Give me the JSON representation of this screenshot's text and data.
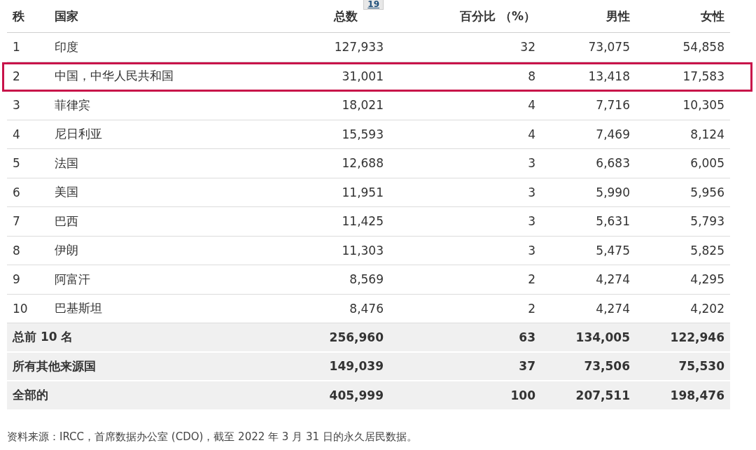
{
  "table": {
    "columns": [
      {
        "label": "秩"
      },
      {
        "label": "国家"
      },
      {
        "label": "总数",
        "footnote": "19"
      },
      {
        "label": "百分比 （%）"
      },
      {
        "label": "男性"
      },
      {
        "label": "女性"
      }
    ],
    "rows": [
      {
        "cells": [
          "1",
          "印度",
          "127,933",
          "32",
          "73,075",
          "54,858"
        ],
        "highlighted": false,
        "summary": false
      },
      {
        "cells": [
          "2",
          "中国，中华人民共和国",
          "31,001",
          "8",
          "13,418",
          "17,583"
        ],
        "highlighted": true,
        "summary": false
      },
      {
        "cells": [
          "3",
          "菲律宾",
          "18,021",
          "4",
          "7,716",
          "10,305"
        ],
        "highlighted": false,
        "summary": false
      },
      {
        "cells": [
          "4",
          "尼日利亚",
          "15,593",
          "4",
          "7,469",
          "8,124"
        ],
        "highlighted": false,
        "summary": false
      },
      {
        "cells": [
          "5",
          "法国",
          "12,688",
          "3",
          "6,683",
          "6,005"
        ],
        "highlighted": false,
        "summary": false
      },
      {
        "cells": [
          "6",
          "美国",
          "11,951",
          "3",
          "5,990",
          "5,956"
        ],
        "highlighted": false,
        "summary": false
      },
      {
        "cells": [
          "7",
          "巴西",
          "11,425",
          "3",
          "5,631",
          "5,793"
        ],
        "highlighted": false,
        "summary": false
      },
      {
        "cells": [
          "8",
          "伊朗",
          "11,303",
          "3",
          "5,475",
          "5,825"
        ],
        "highlighted": false,
        "summary": false
      },
      {
        "cells": [
          "9",
          "阿富汗",
          "8,569",
          "2",
          "4,274",
          "4,295"
        ],
        "highlighted": false,
        "summary": false
      },
      {
        "cells": [
          "10",
          "巴基斯坦",
          "8,476",
          "2",
          "4,274",
          "4,202"
        ],
        "highlighted": false,
        "summary": false
      },
      {
        "cells": [
          "总前 10 名",
          "256,960",
          "63",
          "134,005",
          "122,946"
        ],
        "highlighted": false,
        "summary": true
      },
      {
        "cells": [
          "所有其他来源国",
          "149,039",
          "37",
          "73,506",
          "75,530"
        ],
        "highlighted": false,
        "summary": true
      },
      {
        "cells": [
          "全部的",
          "405,999",
          "100",
          "207,511",
          "198,476"
        ],
        "highlighted": false,
        "summary": true
      }
    ]
  },
  "source_note": "资料来源：IRCC，首席数据办公室 (CDO)，截至 2022 年 3 月 31 日的永久居民数据。"
}
